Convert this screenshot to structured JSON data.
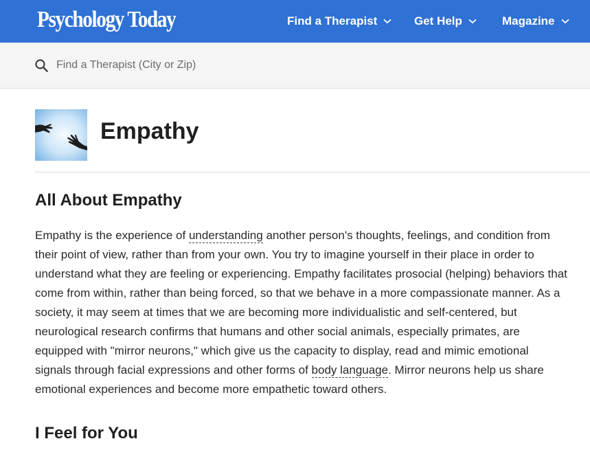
{
  "header": {
    "logo_text": "Psychology Today",
    "nav": [
      {
        "label": "Find a Therapist"
      },
      {
        "label": "Get Help"
      },
      {
        "label": "Magazine"
      }
    ],
    "brand_color": "#2f71d4"
  },
  "search": {
    "placeholder": "Find a Therapist (City or Zip)",
    "icon": "search-icon"
  },
  "topic": {
    "title": "Empathy",
    "image": "reaching-hands"
  },
  "article": {
    "heading": "All About Empathy",
    "lines": [
      {
        "before": "Empathy is the experience of ",
        "link": "understanding",
        "after": " another person's thoughts, feelings, and condition from"
      },
      {
        "text": "their point of view, rather than from your own. You try to imagine yourself in their place in order to"
      },
      {
        "text": "understand what they are feeling or experiencing. Empathy facilitates prosocial (helping) behaviors that"
      },
      {
        "text": "come from within, rather than being forced, so that we behave in a more compassionate manner. As a"
      },
      {
        "text": "society, it may seem at times that we are becoming more individualistic and self-centered, but"
      },
      {
        "text": "neurological research confirms that humans and other social animals, especially primates, are"
      },
      {
        "text": "equipped with \"mirror neurons,\" which give us the capacity to display, read and mimic emotional"
      },
      {
        "before": "signals through facial expressions and other forms of ",
        "link": "body language",
        "after": ". Mirror neurons help us share"
      },
      {
        "text": "emotional experiences and become more empathetic toward others."
      }
    ],
    "subheading": "I Feel for You"
  }
}
